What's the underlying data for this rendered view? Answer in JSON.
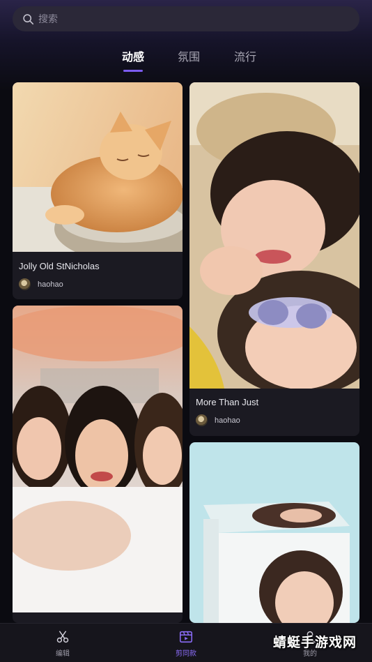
{
  "search": {
    "placeholder": "搜索"
  },
  "tabs": [
    {
      "label": "动感",
      "active": true
    },
    {
      "label": "氛围",
      "active": false
    },
    {
      "label": "流行",
      "active": false
    }
  ],
  "cards": [
    {
      "title": "Jolly Old StNicholas",
      "user": "haohao",
      "image": "sleeping ginger cat on a blanket"
    },
    {
      "title": "More Than Just",
      "user": "haohao",
      "image": "two women lying down, one with sunglasses"
    },
    {
      "title": "",
      "user": "",
      "image": "three women taking a selfie"
    },
    {
      "title": "",
      "user": "",
      "image": "woman inside a glass cube"
    }
  ],
  "bottom_nav": [
    {
      "label": "编辑",
      "icon": "scissors-icon",
      "active": false
    },
    {
      "label": "剪同款",
      "icon": "film-clapper-icon",
      "active": true
    },
    {
      "label": "我的",
      "icon": "user-icon",
      "active": false
    }
  ],
  "watermark": "蜻蜓手游戏网",
  "colors": {
    "accent": "#7b5cf0",
    "background": "#0b0b11",
    "card": "#1b1a22"
  }
}
